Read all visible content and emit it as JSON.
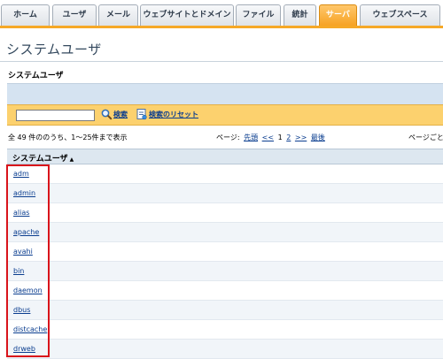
{
  "tabs": [
    {
      "label": "ホーム",
      "active": false
    },
    {
      "label": "ユーザ",
      "active": false
    },
    {
      "label": "メール",
      "active": false
    },
    {
      "label": "ウェブサイトとドメイン",
      "active": false
    },
    {
      "label": "ファイル",
      "active": false
    },
    {
      "label": "統計",
      "active": false
    },
    {
      "label": "サーバ",
      "active": true
    },
    {
      "label": "ウェブスペース",
      "active": false
    }
  ],
  "page": {
    "title": "システムユーザ",
    "section_heading": "システムユーザ"
  },
  "search": {
    "value": "",
    "search_label": "検索",
    "reset_label": "検索のリセット"
  },
  "pagination": {
    "summary": "全 49 件ののうち、1〜25件まで表示",
    "prefix": "ページ:",
    "first": "先頭",
    "prev": "<<",
    "current": "1",
    "page2": "2",
    "next": ">>",
    "last": "最後",
    "per_page": "ページごと"
  },
  "table": {
    "column_header": "システムユーザ",
    "sort": "ascending",
    "rows": [
      "adm",
      "admin",
      "alias",
      "apache",
      "avahi",
      "bin",
      "daemon",
      "dbus",
      "distcache",
      "drweb"
    ]
  },
  "colors": {
    "accent": "#f6a827",
    "active_tab": "#f6a121",
    "search_bar": "#fcd16e",
    "highlight": "#d9141b",
    "link": "#0a3d8f"
  }
}
